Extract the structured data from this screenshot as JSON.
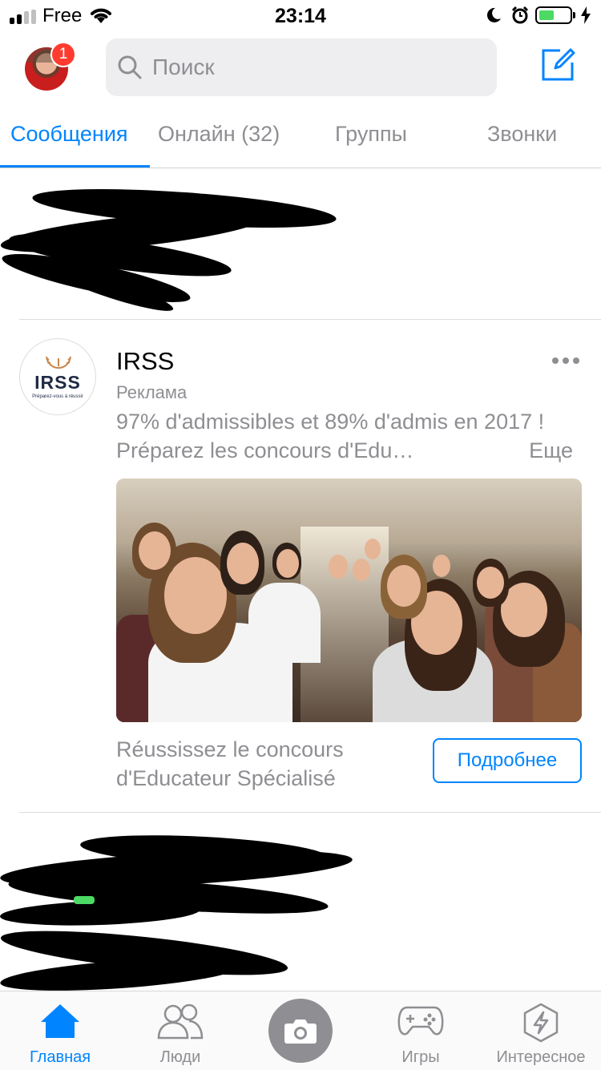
{
  "status_bar": {
    "carrier": "Free",
    "time": "23:14"
  },
  "header": {
    "notification_count": "1",
    "search_placeholder": "Поиск"
  },
  "tabs": [
    {
      "label": "Сообщения",
      "active": true
    },
    {
      "label": "Онлайн (32)",
      "active": false
    },
    {
      "label": "Группы",
      "active": false
    },
    {
      "label": "Звонки",
      "active": false
    }
  ],
  "ad": {
    "logo_text": "IRSS",
    "logo_tagline": "Préparez-vous à réussir",
    "name": "IRSS",
    "sponsored_label": "Реклама",
    "text": "97% d'admissibles et 89% d'admis en 2017 ! Préparez les concours d'Edu…",
    "more_label": "Еще",
    "cta_text": "Réussissez le concours d'Educateur Spécialisé",
    "cta_button": "Подробнее"
  },
  "bottom_nav": [
    {
      "label": "Главная",
      "icon": "home-icon",
      "active": true
    },
    {
      "label": "Люди",
      "icon": "people-icon",
      "active": false
    },
    {
      "label": "",
      "icon": "camera-icon",
      "active": false
    },
    {
      "label": "Игры",
      "icon": "gamepad-icon",
      "active": false
    },
    {
      "label": "Интересное",
      "icon": "discover-icon",
      "active": false
    }
  ],
  "colors": {
    "accent": "#0084ff",
    "badge": "#ff3b30",
    "secondary_text": "#8e8e93",
    "battery": "#4cd964"
  }
}
